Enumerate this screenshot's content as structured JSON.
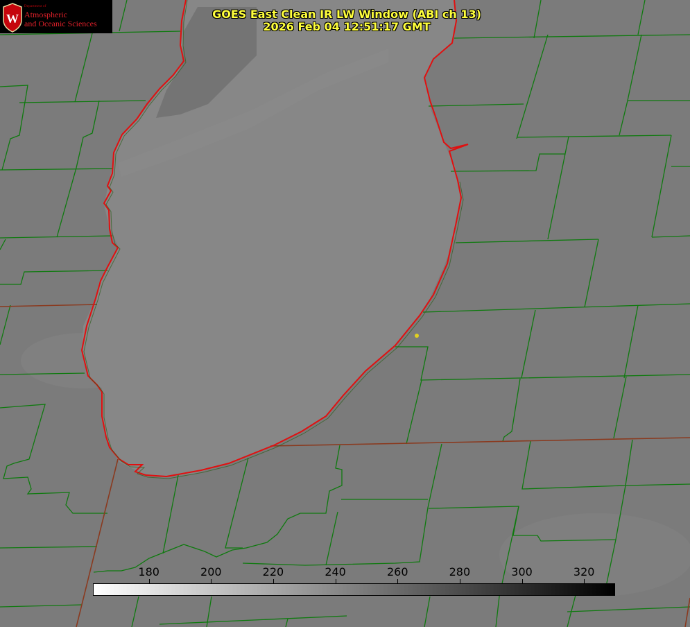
{
  "title": {
    "line1": "GOES East Clean IR LW Window (ABI ch 13)",
    "line2": "2026 Feb 04 12:51:17 GMT"
  },
  "logo": {
    "department": "Department of",
    "name_line1": "Atmospheric",
    "name_line2": "and Oceanic Sciences",
    "crest_letter": "W"
  },
  "colorbar": {
    "ticks": [
      "180",
      "200",
      "220",
      "240",
      "260",
      "280",
      "300",
      "320"
    ],
    "range": [
      162,
      330
    ],
    "colormap": "white-to-black (grayscale IR)"
  },
  "colors": {
    "background_gray": "#7b7b7b",
    "lake_gray": "#858585",
    "county_lines": "#0f7a0f",
    "state_lines": "#8a3a1f",
    "shoreline": "#e01010",
    "title": "#ffff3c",
    "marker": "#e0d020"
  }
}
